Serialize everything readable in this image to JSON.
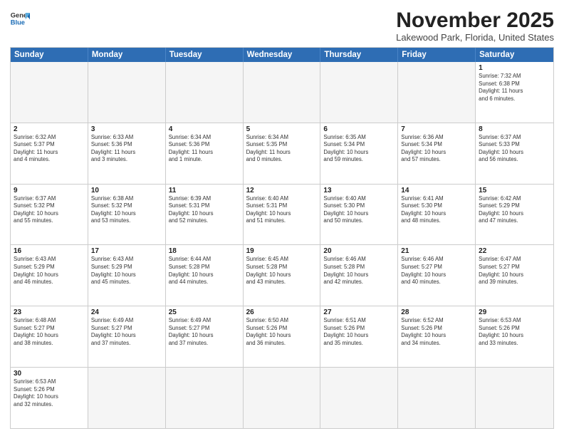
{
  "logo": {
    "line1": "General",
    "line2": "Blue"
  },
  "title": "November 2025",
  "location": "Lakewood Park, Florida, United States",
  "days": [
    "Sunday",
    "Monday",
    "Tuesday",
    "Wednesday",
    "Thursday",
    "Friday",
    "Saturday"
  ],
  "rows": [
    [
      {
        "date": "",
        "info": "",
        "empty": true
      },
      {
        "date": "",
        "info": "",
        "empty": true
      },
      {
        "date": "",
        "info": "",
        "empty": true
      },
      {
        "date": "",
        "info": "",
        "empty": true
      },
      {
        "date": "",
        "info": "",
        "empty": true
      },
      {
        "date": "",
        "info": "",
        "empty": true
      },
      {
        "date": "1",
        "info": "Sunrise: 7:32 AM\nSunset: 6:38 PM\nDaylight: 11 hours\nand 6 minutes.",
        "empty": false
      }
    ],
    [
      {
        "date": "2",
        "info": "Sunrise: 6:32 AM\nSunset: 5:37 PM\nDaylight: 11 hours\nand 4 minutes.",
        "empty": false
      },
      {
        "date": "3",
        "info": "Sunrise: 6:33 AM\nSunset: 5:36 PM\nDaylight: 11 hours\nand 3 minutes.",
        "empty": false
      },
      {
        "date": "4",
        "info": "Sunrise: 6:34 AM\nSunset: 5:36 PM\nDaylight: 11 hours\nand 1 minute.",
        "empty": false
      },
      {
        "date": "5",
        "info": "Sunrise: 6:34 AM\nSunset: 5:35 PM\nDaylight: 11 hours\nand 0 minutes.",
        "empty": false
      },
      {
        "date": "6",
        "info": "Sunrise: 6:35 AM\nSunset: 5:34 PM\nDaylight: 10 hours\nand 59 minutes.",
        "empty": false
      },
      {
        "date": "7",
        "info": "Sunrise: 6:36 AM\nSunset: 5:34 PM\nDaylight: 10 hours\nand 57 minutes.",
        "empty": false
      },
      {
        "date": "8",
        "info": "Sunrise: 6:37 AM\nSunset: 5:33 PM\nDaylight: 10 hours\nand 56 minutes.",
        "empty": false
      }
    ],
    [
      {
        "date": "9",
        "info": "Sunrise: 6:37 AM\nSunset: 5:32 PM\nDaylight: 10 hours\nand 55 minutes.",
        "empty": false
      },
      {
        "date": "10",
        "info": "Sunrise: 6:38 AM\nSunset: 5:32 PM\nDaylight: 10 hours\nand 53 minutes.",
        "empty": false
      },
      {
        "date": "11",
        "info": "Sunrise: 6:39 AM\nSunset: 5:31 PM\nDaylight: 10 hours\nand 52 minutes.",
        "empty": false
      },
      {
        "date": "12",
        "info": "Sunrise: 6:40 AM\nSunset: 5:31 PM\nDaylight: 10 hours\nand 51 minutes.",
        "empty": false
      },
      {
        "date": "13",
        "info": "Sunrise: 6:40 AM\nSunset: 5:30 PM\nDaylight: 10 hours\nand 50 minutes.",
        "empty": false
      },
      {
        "date": "14",
        "info": "Sunrise: 6:41 AM\nSunset: 5:30 PM\nDaylight: 10 hours\nand 48 minutes.",
        "empty": false
      },
      {
        "date": "15",
        "info": "Sunrise: 6:42 AM\nSunset: 5:29 PM\nDaylight: 10 hours\nand 47 minutes.",
        "empty": false
      }
    ],
    [
      {
        "date": "16",
        "info": "Sunrise: 6:43 AM\nSunset: 5:29 PM\nDaylight: 10 hours\nand 46 minutes.",
        "empty": false
      },
      {
        "date": "17",
        "info": "Sunrise: 6:43 AM\nSunset: 5:29 PM\nDaylight: 10 hours\nand 45 minutes.",
        "empty": false
      },
      {
        "date": "18",
        "info": "Sunrise: 6:44 AM\nSunset: 5:28 PM\nDaylight: 10 hours\nand 44 minutes.",
        "empty": false
      },
      {
        "date": "19",
        "info": "Sunrise: 6:45 AM\nSunset: 5:28 PM\nDaylight: 10 hours\nand 43 minutes.",
        "empty": false
      },
      {
        "date": "20",
        "info": "Sunrise: 6:46 AM\nSunset: 5:28 PM\nDaylight: 10 hours\nand 42 minutes.",
        "empty": false
      },
      {
        "date": "21",
        "info": "Sunrise: 6:46 AM\nSunset: 5:27 PM\nDaylight: 10 hours\nand 40 minutes.",
        "empty": false
      },
      {
        "date": "22",
        "info": "Sunrise: 6:47 AM\nSunset: 5:27 PM\nDaylight: 10 hours\nand 39 minutes.",
        "empty": false
      }
    ],
    [
      {
        "date": "23",
        "info": "Sunrise: 6:48 AM\nSunset: 5:27 PM\nDaylight: 10 hours\nand 38 minutes.",
        "empty": false
      },
      {
        "date": "24",
        "info": "Sunrise: 6:49 AM\nSunset: 5:27 PM\nDaylight: 10 hours\nand 37 minutes.",
        "empty": false
      },
      {
        "date": "25",
        "info": "Sunrise: 6:49 AM\nSunset: 5:27 PM\nDaylight: 10 hours\nand 37 minutes.",
        "empty": false
      },
      {
        "date": "26",
        "info": "Sunrise: 6:50 AM\nSunset: 5:26 PM\nDaylight: 10 hours\nand 36 minutes.",
        "empty": false
      },
      {
        "date": "27",
        "info": "Sunrise: 6:51 AM\nSunset: 5:26 PM\nDaylight: 10 hours\nand 35 minutes.",
        "empty": false
      },
      {
        "date": "28",
        "info": "Sunrise: 6:52 AM\nSunset: 5:26 PM\nDaylight: 10 hours\nand 34 minutes.",
        "empty": false
      },
      {
        "date": "29",
        "info": "Sunrise: 6:53 AM\nSunset: 5:26 PM\nDaylight: 10 hours\nand 33 minutes.",
        "empty": false
      }
    ],
    [
      {
        "date": "30",
        "info": "Sunrise: 6:53 AM\nSunset: 5:26 PM\nDaylight: 10 hours\nand 32 minutes.",
        "empty": false
      },
      {
        "date": "",
        "info": "",
        "empty": true
      },
      {
        "date": "",
        "info": "",
        "empty": true
      },
      {
        "date": "",
        "info": "",
        "empty": true
      },
      {
        "date": "",
        "info": "",
        "empty": true
      },
      {
        "date": "",
        "info": "",
        "empty": true
      },
      {
        "date": "",
        "info": "",
        "empty": true
      }
    ]
  ]
}
